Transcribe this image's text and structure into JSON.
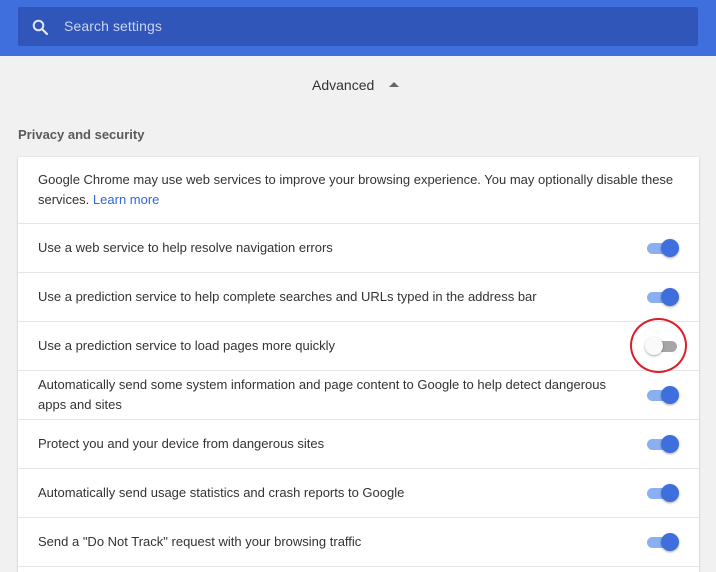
{
  "search": {
    "placeholder": "Search settings",
    "icon": "search-icon"
  },
  "advanced": {
    "label": "Advanced",
    "icon": "caret-up-icon"
  },
  "section": {
    "title": "Privacy and security"
  },
  "intro": {
    "text": "Google Chrome may use web services to improve your browsing experience. You may optionally disable these services.",
    "link": "Learn more"
  },
  "settings": [
    {
      "label": "Use a web service to help resolve navigation errors",
      "enabled": true
    },
    {
      "label": "Use a prediction service to help complete searches and URLs typed in the address bar",
      "enabled": true
    },
    {
      "label": "Use a prediction service to load pages more quickly",
      "enabled": false
    },
    {
      "label": "Automatically send some system information and page content to Google to help detect dangerous apps and sites",
      "enabled": true
    },
    {
      "label": "Protect you and your device from dangerous sites",
      "enabled": true
    },
    {
      "label": "Automatically send usage statistics and crash reports to Google",
      "enabled": true
    },
    {
      "label": "Send a \"Do Not Track\" request with your browsing traffic",
      "enabled": true
    }
  ],
  "colors": {
    "header": "#3e6fdd",
    "toggle_on": "#3e6fdd",
    "link": "#3367d6",
    "annotation": "#d9202a"
  }
}
